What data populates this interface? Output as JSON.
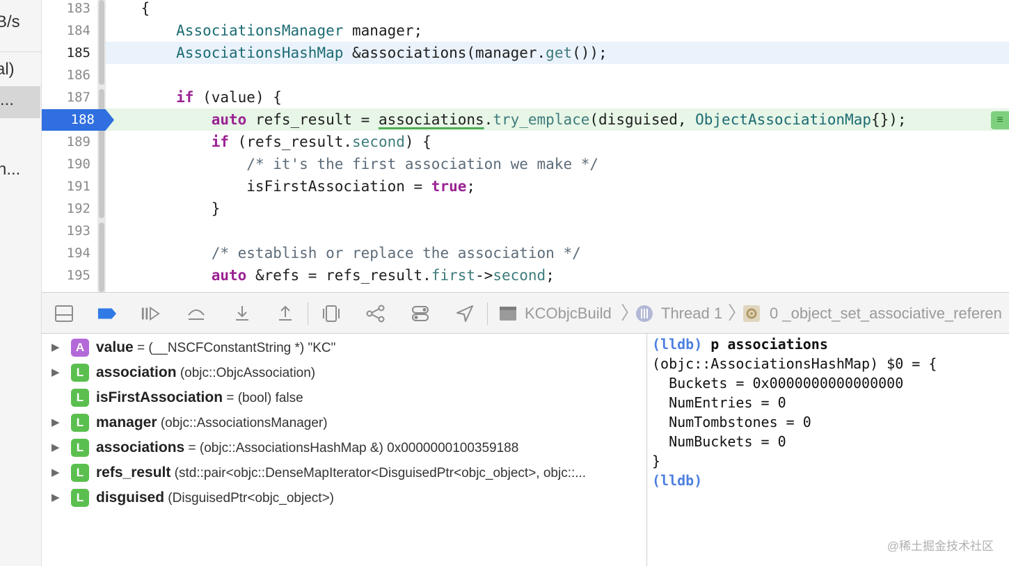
{
  "sidebar": {
    "items": [
      {
        "label": "B/s"
      },
      {
        "label": "al)"
      },
      {
        "label": "..."
      },
      {
        "label": "n..."
      }
    ]
  },
  "editor": {
    "current_line": "185",
    "breakpoint_line": "188",
    "lines": [
      {
        "num": "183",
        "segments": [
          {
            "t": "    {",
            "c": "p"
          }
        ]
      },
      {
        "num": "184",
        "segments": [
          {
            "t": "        ",
            "c": "p"
          },
          {
            "t": "AssociationsManager",
            "c": "ty"
          },
          {
            "t": " manager;",
            "c": "p"
          }
        ]
      },
      {
        "num": "185",
        "segments": [
          {
            "t": "        ",
            "c": "p"
          },
          {
            "t": "AssociationsHashMap",
            "c": "ty"
          },
          {
            "t": " &associations(manager.",
            "c": "p"
          },
          {
            "t": "get",
            "c": "fn"
          },
          {
            "t": "());",
            "c": "p"
          }
        ]
      },
      {
        "num": "186",
        "segments": []
      },
      {
        "num": "187",
        "segments": [
          {
            "t": "        ",
            "c": "p"
          },
          {
            "t": "if",
            "c": "kw"
          },
          {
            "t": " (value) {",
            "c": "p"
          }
        ]
      },
      {
        "num": "188",
        "segments": [
          {
            "t": "            ",
            "c": "p"
          },
          {
            "t": "auto",
            "c": "kw"
          },
          {
            "t": " refs_result = ",
            "c": "p"
          },
          {
            "t": "associations",
            "c": "ul"
          },
          {
            "t": ".",
            "c": "p"
          },
          {
            "t": "try_emplace",
            "c": "fn"
          },
          {
            "t": "(disguised, ",
            "c": "p"
          },
          {
            "t": "ObjectAssociationMap",
            "c": "ty"
          },
          {
            "t": "{});",
            "c": "p"
          }
        ]
      },
      {
        "num": "189",
        "segments": [
          {
            "t": "            ",
            "c": "p"
          },
          {
            "t": "if",
            "c": "kw"
          },
          {
            "t": " (refs_result.",
            "c": "p"
          },
          {
            "t": "second",
            "c": "fn"
          },
          {
            "t": ") {",
            "c": "p"
          }
        ]
      },
      {
        "num": "190",
        "segments": [
          {
            "t": "                ",
            "c": "p"
          },
          {
            "t": "/* it's the first association we make */",
            "c": "cm"
          }
        ]
      },
      {
        "num": "191",
        "segments": [
          {
            "t": "                isFirstAssociation = ",
            "c": "p"
          },
          {
            "t": "true",
            "c": "kw"
          },
          {
            "t": ";",
            "c": "p"
          }
        ]
      },
      {
        "num": "192",
        "segments": [
          {
            "t": "            }",
            "c": "p"
          }
        ]
      },
      {
        "num": "193",
        "segments": []
      },
      {
        "num": "194",
        "segments": [
          {
            "t": "            ",
            "c": "p"
          },
          {
            "t": "/* establish or replace the association */",
            "c": "cm"
          }
        ]
      },
      {
        "num": "195",
        "segments": [
          {
            "t": "            ",
            "c": "p"
          },
          {
            "t": "auto",
            "c": "kw"
          },
          {
            "t": " &refs = refs_result.",
            "c": "p"
          },
          {
            "t": "first",
            "c": "fn"
          },
          {
            "t": "->",
            "c": "p"
          },
          {
            "t": "second",
            "c": "fn"
          },
          {
            "t": ";",
            "c": "p"
          }
        ]
      }
    ]
  },
  "debug_bar": {
    "target": "KCObjcBuild",
    "thread": "Thread 1",
    "frame": "0 _object_set_associative_referen"
  },
  "variables": [
    {
      "badge": "A",
      "expandable": true,
      "name": "value",
      "rest": " = (__NSCFConstantString *) \"KC\""
    },
    {
      "badge": "L",
      "expandable": true,
      "name": "association",
      "rest": " (objc::ObjcAssociation)"
    },
    {
      "badge": "L",
      "expandable": false,
      "name": "isFirstAssociation",
      "rest": " = (bool) false"
    },
    {
      "badge": "L",
      "expandable": true,
      "name": "manager",
      "rest": " (objc::AssociationsManager)"
    },
    {
      "badge": "L",
      "expandable": true,
      "name": "associations",
      "rest": " = (objc::AssociationsHashMap &) 0x0000000100359188"
    },
    {
      "badge": "L",
      "expandable": true,
      "name": "refs_result",
      "rest": " (std::pair<objc::DenseMapIterator<DisguisedPtr<objc_object>, objc::..."
    },
    {
      "badge": "L",
      "expandable": true,
      "name": "disguised",
      "rest": " (DisguisedPtr<objc_object>)"
    }
  ],
  "console": {
    "lines": [
      {
        "prompt": "(lldb)",
        "text": " p associations"
      },
      {
        "prompt": "",
        "text": "(objc::AssociationsHashMap) $0 = {"
      },
      {
        "prompt": "",
        "text": "  Buckets = 0x0000000000000000"
      },
      {
        "prompt": "",
        "text": "  NumEntries = 0"
      },
      {
        "prompt": "",
        "text": "  NumTombstones = 0"
      },
      {
        "prompt": "",
        "text": "  NumBuckets = 0"
      },
      {
        "prompt": "",
        "text": "}"
      },
      {
        "prompt": "(lldb)",
        "text": ""
      }
    ],
    "watermark": "@稀土掘金技术社区"
  }
}
